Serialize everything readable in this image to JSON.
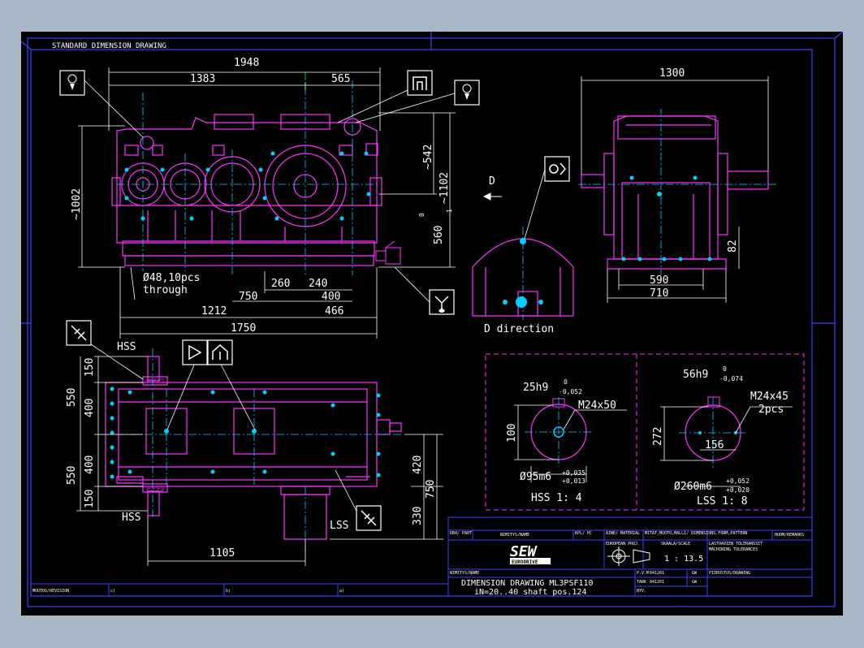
{
  "sheet": {
    "header_label": "STANDARD DIMENSION DRAWING"
  },
  "front_view": {
    "dims": {
      "overall_length": "1948",
      "left_part": "1383",
      "right_part": "565",
      "overall_height": "~1002",
      "upper_height": "~542",
      "total_height": "~1102",
      "shaft_height": "560",
      "shaft_height_tol_upper": "0",
      "shaft_height_tol_lower": "-1",
      "bolt_note_1": "Ø48,10pcs",
      "bolt_note_2": "through",
      "d260": "260",
      "d240": "240",
      "d750": "750",
      "d400": "400",
      "d1212": "1212",
      "d466": "466",
      "d1750": "1750"
    }
  },
  "side_view": {
    "dims": {
      "width": "1300",
      "base_590": "590",
      "base_710": "710",
      "height_82": "82"
    }
  },
  "d_view": {
    "arrow_label": "D",
    "caption": "D direction"
  },
  "top_view": {
    "dims": {
      "hss_top": "HSS",
      "hss_bottom": "HSS",
      "lss": "LSS",
      "d150_top": "150",
      "d400_top": "400",
      "d550_top": "550",
      "d400_bottom": "400",
      "d550_bottom": "550",
      "d150_bottom": "150",
      "d420": "420",
      "d750": "750",
      "d330": "330",
      "d1105": "1105"
    }
  },
  "detail_hss": {
    "key": "25h9",
    "key_tol_upper": "0",
    "key_tol_lower": "-0,052",
    "thread": "M24x50",
    "dim_100": "100",
    "dia": "Ø95m6",
    "dia_tol_upper": "+0,035",
    "dia_tol_lower": "+0,013",
    "scale_label": "HSS 1: 4"
  },
  "detail_lss": {
    "key": "56h9",
    "key_tol_upper": "0",
    "key_tol_lower": "-0,074",
    "thread": "M24x45",
    "pcs": "2pcs",
    "dim_272": "272",
    "dim_156": "156",
    "dia": "Ø260m6",
    "dia_tol_upper": "+0,052",
    "dia_tol_lower": "+0,020",
    "scale_label": "LSS 1: 8"
  },
  "title_block": {
    "row1_c1": "DB4/ PART",
    "row1_c2": "NIMITYS/NAME",
    "row1_c3": "KPL/ PC",
    "row1_c4": "AINE/ MATERIAL",
    "row1_c5": "MITAT,MUOTO,MALLI/ DIMENSIONS,FORM,PATTERN",
    "row1_c6": "HUOM/REMARKS",
    "projection_label": "EUROPEAN PROJ.",
    "scale_head": "SKAALA/SCALE",
    "scale_value": "1 : 13.5",
    "tolerances_head": "LASTUAVIEN TOLERANSSIT",
    "tolerances_sub": "MACHINING TOLERANCES",
    "name_label": "NIMITYS/NAME",
    "title_line1": "DIMENSION DRAWING ML3PSF110",
    "title_line2": "iN=20..40    shaft pos.124",
    "pvm_label": "P.V.M",
    "pvm_value": "041201",
    "pvm_sign": "GW",
    "tark_label": "TARK",
    "tark_value": "041201",
    "tark_sign": "GW",
    "hyv_label": "HYV.",
    "drawing_no_label": "PIIRUSTUS/DRAWING",
    "revision_label": "MUUTOS/REVISION",
    "rev_c": "c)",
    "rev_b": "b)",
    "rev_a": "a)",
    "brand_main": "SEW",
    "brand_sub": "EURODRIVE"
  },
  "colors": {
    "frame": "#4040ff",
    "outline": "#ff33ff",
    "center": "#00d0ff",
    "dims": "#ffffff",
    "background": "#000000"
  },
  "icons": [
    "lifting-eye-icon",
    "oil-fill-icon",
    "lifting-eye-icon",
    "oil-drain-icon",
    "oil-level-icon",
    "breather-icon",
    "oil-sight-icon",
    "oil-gauge-icon",
    "oil-fill-right-icon"
  ]
}
